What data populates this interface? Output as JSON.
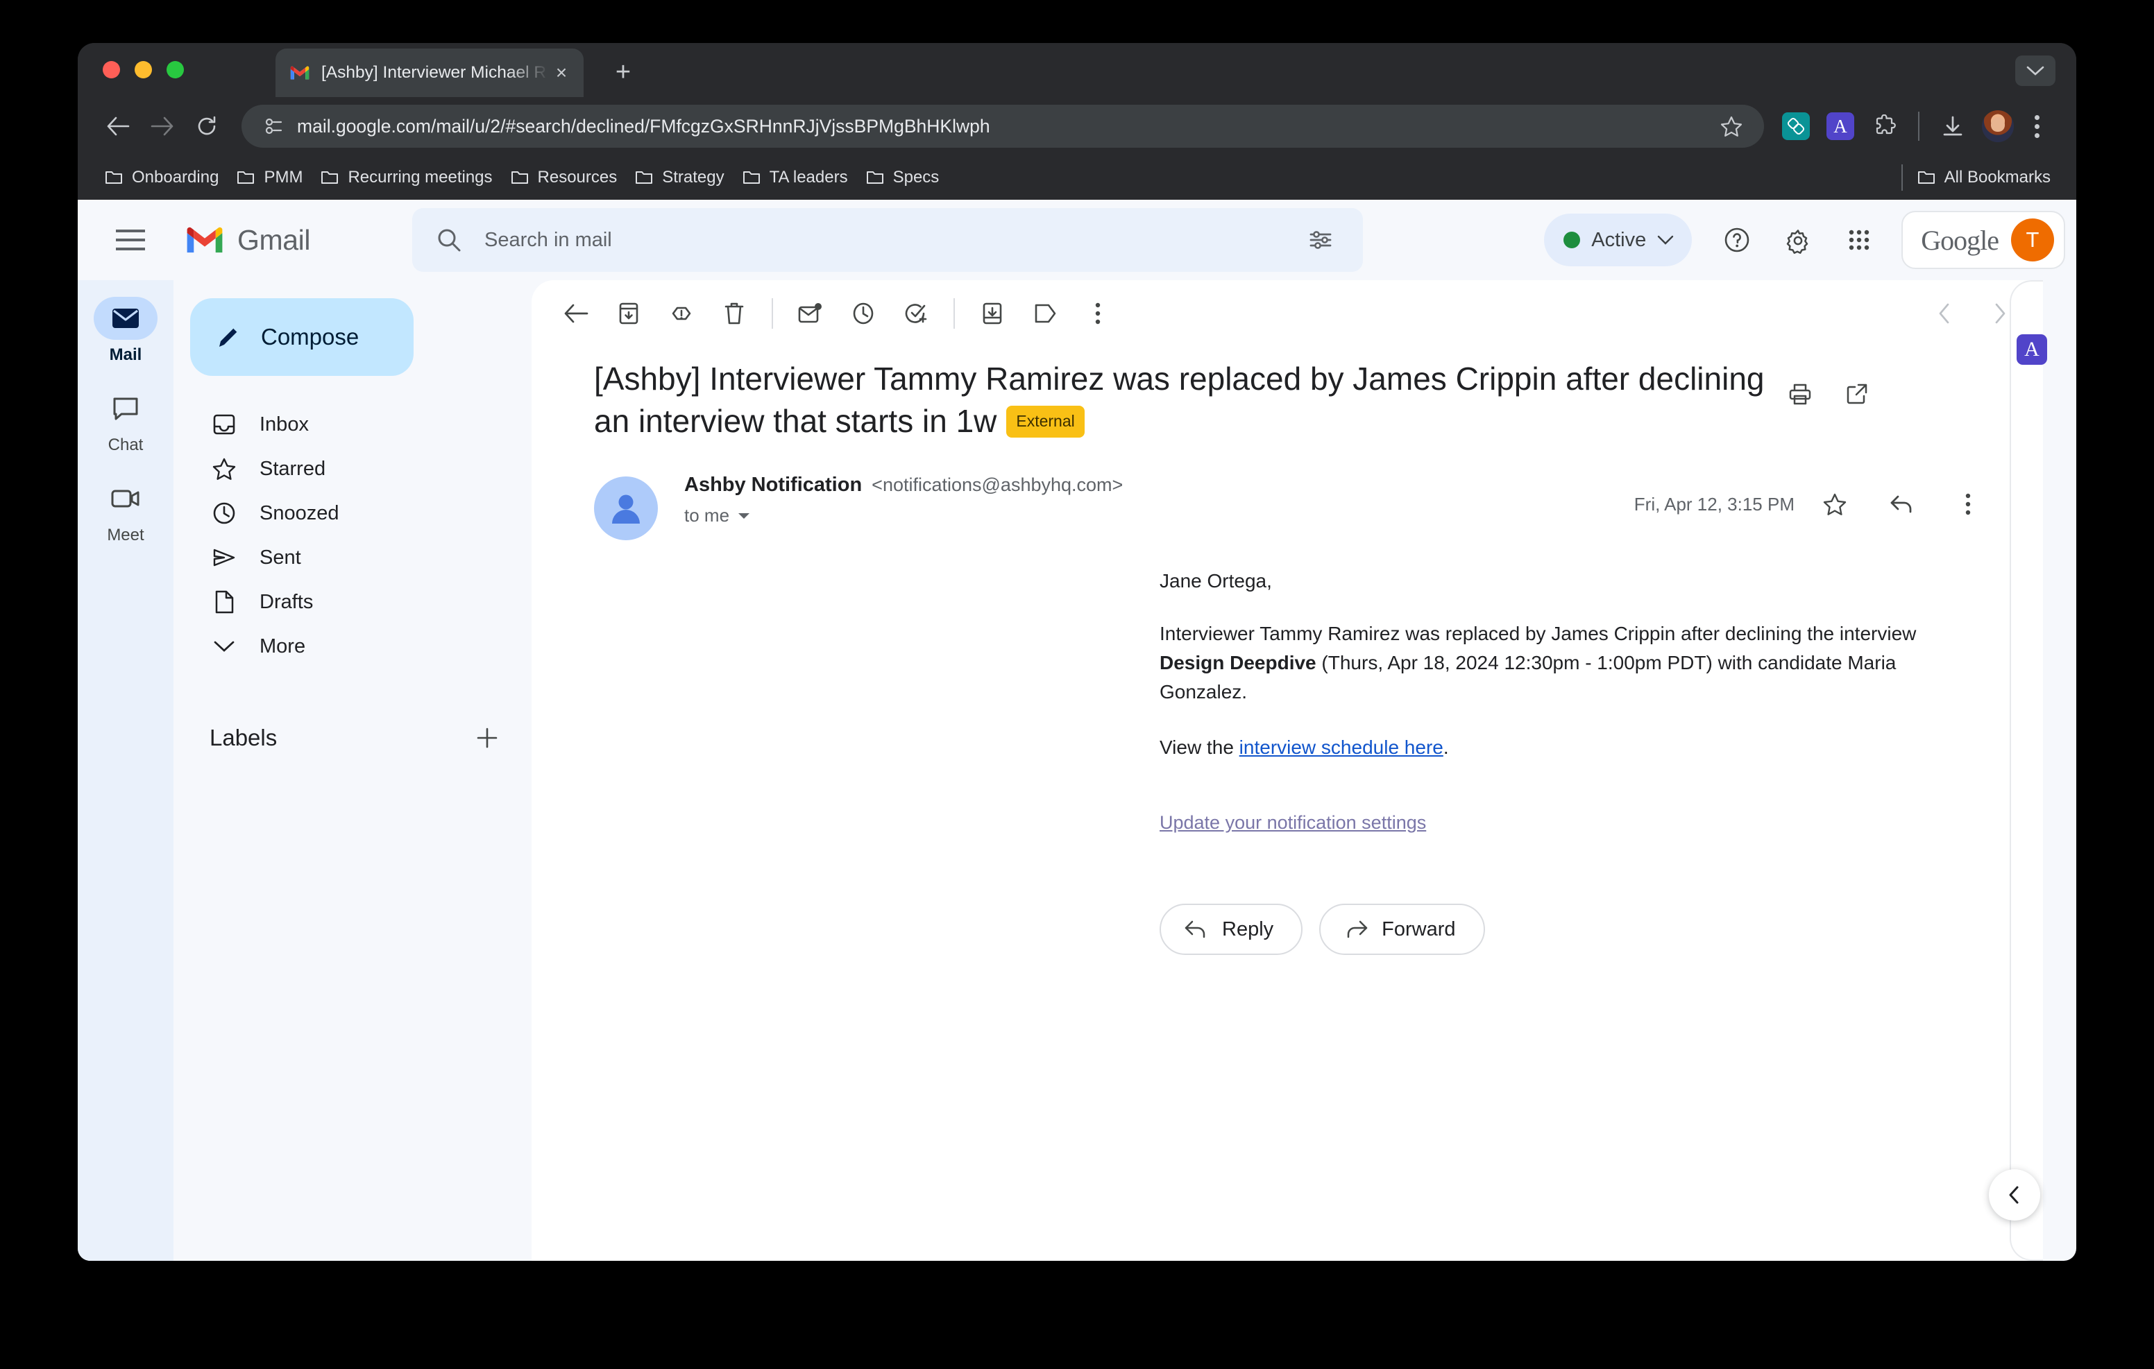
{
  "browser": {
    "tab": {
      "title": "[Ashby] Interviewer Michael R",
      "close_label": "×",
      "new_tab_label": "+"
    },
    "url": "mail.google.com/mail/u/2/#search/declined/FMfcgzGxSRHnnRJjVjssBPMgBhHKlwph",
    "bookmarks": [
      {
        "label": "Onboarding"
      },
      {
        "label": "PMM"
      },
      {
        "label": "Recurring meetings"
      },
      {
        "label": "Resources"
      },
      {
        "label": "Strategy"
      },
      {
        "label": "TA leaders"
      },
      {
        "label": "Specs"
      }
    ],
    "all_bookmarks_label": "All Bookmarks",
    "extensions": [
      {
        "name": "teal-links-extension",
        "letter": "",
        "color": "#0a9396"
      },
      {
        "name": "ashby-extension",
        "letter": "A",
        "color": "#5144c9"
      }
    ]
  },
  "gmail": {
    "logo_text": "Gmail",
    "search": {
      "placeholder": "Search in mail"
    },
    "status": {
      "label": "Active",
      "dot_color": "#1e8e3e"
    },
    "account": {
      "google_word": "Google",
      "avatar_initial": "T",
      "avatar_color": "#ef6c00"
    },
    "rail": [
      {
        "label": "Mail",
        "active": true
      },
      {
        "label": "Chat",
        "active": false
      },
      {
        "label": "Meet",
        "active": false
      }
    ],
    "compose_label": "Compose",
    "nav_items": [
      {
        "label": "Inbox"
      },
      {
        "label": "Starred"
      },
      {
        "label": "Snoozed"
      },
      {
        "label": "Sent"
      },
      {
        "label": "Drafts"
      },
      {
        "label": "More"
      }
    ],
    "labels_section": {
      "title": "Labels",
      "add_label": "+"
    }
  },
  "email": {
    "subject": "[Ashby] Interviewer Tammy Ramirez was replaced by James Crippin after declining an interview that starts in 1w",
    "external_badge": "External",
    "sender_name": "Ashby Notification",
    "sender_email": "<notifications@ashbyhq.com>",
    "recipient": "to me",
    "date": "Fri, Apr 12, 3:15 PM",
    "body": {
      "greeting": "Jane Ortega,",
      "para_before_bold": "Interviewer Tammy Ramirez was replaced by James Crippin after declining the interview ",
      "bold_text": "Design Deepdive",
      "para_after_bold": " (Thurs, Apr 18, 2024 12:30pm - 1:00pm PDT) with candidate Maria Gonzalez.",
      "view_prefix": "View the ",
      "view_link": "interview schedule here",
      "view_suffix": ".",
      "settings_link": "Update your notification settings"
    },
    "actions": {
      "reply": "Reply",
      "forward": "Forward"
    },
    "side_panel_app": "A"
  }
}
